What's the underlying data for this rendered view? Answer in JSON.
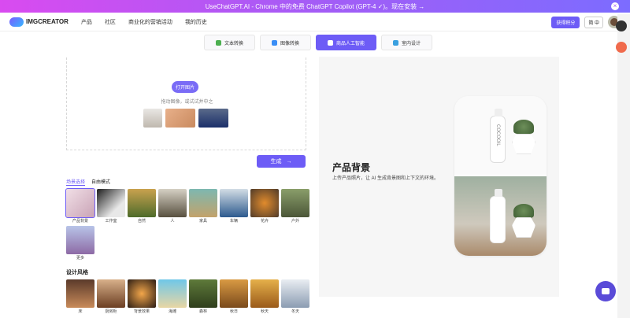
{
  "banner": {
    "text": "UseChatGPT.AI - Chrome 中的免费 ChatGPT Copilot (GPT-4 ✓)。现在安装 →"
  },
  "brand": {
    "name": "IMGCREATOR",
    "accent": "#6d5cf6"
  },
  "nav": {
    "items": [
      "产品",
      "社区",
      "商业化的营销活动",
      "我的历史"
    ]
  },
  "header": {
    "vip": "获得积分",
    "lang": "简 中"
  },
  "tabs": [
    {
      "label": "文本转换"
    },
    {
      "label": "图像转换"
    },
    {
      "label": "商品人工智能"
    },
    {
      "label": "室内设计"
    }
  ],
  "upload": {
    "open_label": "打开图片",
    "hint": "拖动图像，或试试并中之"
  },
  "generate": {
    "label": "生成"
  },
  "subtabs": {
    "first": "场景选择",
    "second": "自由模式"
  },
  "scenes": [
    {
      "label": "产品背景"
    },
    {
      "label": "工作室"
    },
    {
      "label": "自然"
    },
    {
      "label": "人"
    },
    {
      "label": "家具"
    },
    {
      "label": "车辆"
    },
    {
      "label": "花卉"
    },
    {
      "label": "户外"
    },
    {
      "label": "更多"
    }
  ],
  "styles_heading": "设计风格",
  "styles": [
    {
      "label": "床"
    },
    {
      "label": "厨房柜"
    },
    {
      "label": "背景效果"
    },
    {
      "label": "海滩"
    },
    {
      "label": "森林"
    },
    {
      "label": "秋日"
    },
    {
      "label": "秋天"
    },
    {
      "label": "冬天"
    }
  ],
  "preview": {
    "title": "产品背景",
    "desc": "上传产品照片，让 AI 生成背景图和上下文的环境。",
    "bottle_text": "COCOOIL"
  }
}
